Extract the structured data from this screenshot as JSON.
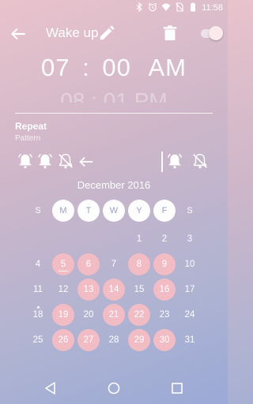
{
  "status_bar": {
    "time": "11:58",
    "icons": [
      "bluetooth-icon",
      "alarm-icon",
      "wifi-icon",
      "no-sim-icon",
      "battery-icon"
    ]
  },
  "app_bar": {
    "title": "Wake up",
    "back_icon": "arrow-left-icon",
    "edit_icon": "pencil-icon",
    "delete_icon": "trash-icon",
    "enabled": true
  },
  "time": {
    "hour": "07",
    "separator": ":",
    "minute": "00",
    "ampm": "AM",
    "next_hint": "08 : 01 PM"
  },
  "repeat": {
    "title": "Repeat",
    "subtitle": "Pattern",
    "pattern_left": [
      "alarm-on",
      "alarm-on",
      "alarm-off"
    ],
    "pattern_right": [
      "alarm-on",
      "alarm-off"
    ]
  },
  "calendar": {
    "month": "December 2016",
    "weekdays": [
      {
        "label": "S",
        "active": false
      },
      {
        "label": "M",
        "active": true
      },
      {
        "label": "T",
        "active": true
      },
      {
        "label": "W",
        "active": true
      },
      {
        "label": "Y",
        "active": true
      },
      {
        "label": "F",
        "active": true
      },
      {
        "label": "S",
        "active": false
      }
    ],
    "weeks": [
      [
        null,
        null,
        null,
        null,
        {
          "d": "1"
        },
        {
          "d": "2"
        },
        {
          "d": "3"
        }
      ],
      [
        {
          "d": "4"
        },
        {
          "d": "5",
          "sel": true,
          "today": true
        },
        {
          "d": "6",
          "sel": true
        },
        {
          "d": "7"
        },
        {
          "d": "8",
          "sel": true
        },
        {
          "d": "9",
          "sel": true
        },
        {
          "d": "10"
        }
      ],
      [
        {
          "d": "11"
        },
        {
          "d": "12"
        },
        {
          "d": "13",
          "sel": true
        },
        {
          "d": "14",
          "sel": true
        },
        {
          "d": "15"
        },
        {
          "d": "16",
          "sel": true
        },
        {
          "d": "17"
        }
      ],
      [
        {
          "d": "18",
          "dot": true
        },
        {
          "d": "19",
          "sel": true
        },
        {
          "d": "20"
        },
        {
          "d": "21",
          "sel": true
        },
        {
          "d": "22",
          "sel": true
        },
        {
          "d": "23"
        },
        {
          "d": "24"
        }
      ],
      [
        {
          "d": "25"
        },
        {
          "d": "26",
          "sel": true
        },
        {
          "d": "27",
          "sel": true
        },
        {
          "d": "28"
        },
        {
          "d": "29",
          "sel": true
        },
        {
          "d": "30",
          "sel": true
        },
        {
          "d": "31"
        }
      ]
    ]
  },
  "nav": {
    "back": "back-triangle-icon",
    "home": "home-circle-icon",
    "recents": "recents-square-icon"
  }
}
